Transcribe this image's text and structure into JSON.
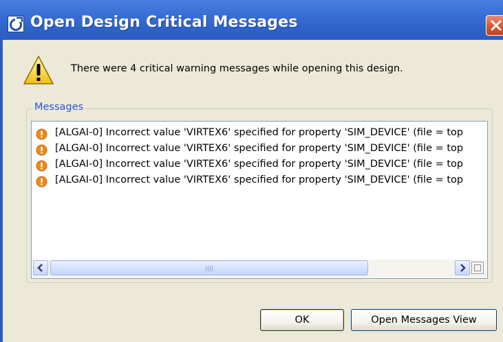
{
  "window": {
    "title": "Open Design Critical Messages",
    "title_icon": "app-logo-icon",
    "close_icon": "close-icon"
  },
  "header": {
    "warning_icon": "warning-triangle-icon",
    "message": "There were 4 critical warning messages while opening this design."
  },
  "messages_group": {
    "label": "Messages",
    "items": [
      {
        "icon": "critical-warning-icon",
        "text": "[ALGAI-0] Incorrect value 'VIRTEX6' specified for property 'SIM_DEVICE' (file = top"
      },
      {
        "icon": "critical-warning-icon",
        "text": "[ALGAI-0] Incorrect value 'VIRTEX6' specified for property 'SIM_DEVICE' (file = top"
      },
      {
        "icon": "critical-warning-icon",
        "text": "[ALGAI-0] Incorrect value 'VIRTEX6' specified for property 'SIM_DEVICE' (file = top"
      },
      {
        "icon": "critical-warning-icon",
        "text": "[ALGAI-0] Incorrect value 'VIRTEX6' specified for property 'SIM_DEVICE' (file = top"
      }
    ]
  },
  "buttons": {
    "ok_label": "OK",
    "open_messages_view_label": "Open Messages View"
  },
  "colors": {
    "titlebar": "#2f63c8",
    "dialog_bg": "#ECE9D8",
    "group_label": "#2c53d5",
    "warning_orange": "#f08a16"
  }
}
